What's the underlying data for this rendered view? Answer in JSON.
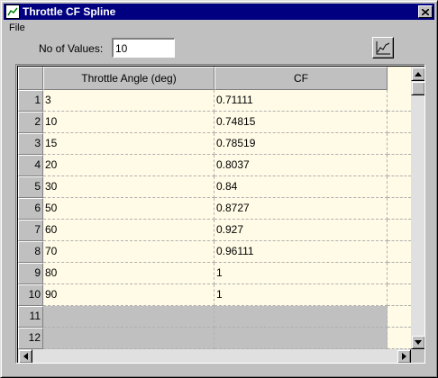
{
  "window": {
    "title": "Throttle CF Spline"
  },
  "menu": {
    "file": "File"
  },
  "nov": {
    "label": "No of Values:",
    "value": "10"
  },
  "grid": {
    "columns": [
      "Throttle Angle (deg)",
      "CF"
    ],
    "rows": [
      {
        "num": "1",
        "angle": "3",
        "cf": "0.71111"
      },
      {
        "num": "2",
        "angle": "10",
        "cf": "0.74815"
      },
      {
        "num": "3",
        "angle": "15",
        "cf": "0.78519"
      },
      {
        "num": "4",
        "angle": "20",
        "cf": "0.8037"
      },
      {
        "num": "5",
        "angle": "30",
        "cf": "0.84"
      },
      {
        "num": "6",
        "angle": "50",
        "cf": "0.8727"
      },
      {
        "num": "7",
        "angle": "60",
        "cf": "0.927"
      },
      {
        "num": "8",
        "angle": "70",
        "cf": "0.96111"
      },
      {
        "num": "9",
        "angle": "80",
        "cf": "1"
      },
      {
        "num": "10",
        "angle": "90",
        "cf": "1"
      },
      {
        "num": "11",
        "angle": "",
        "cf": ""
      },
      {
        "num": "12",
        "angle": "",
        "cf": ""
      }
    ]
  },
  "icons": {
    "chart": "line-chart-icon",
    "close": "close-icon",
    "app": "app-icon"
  }
}
